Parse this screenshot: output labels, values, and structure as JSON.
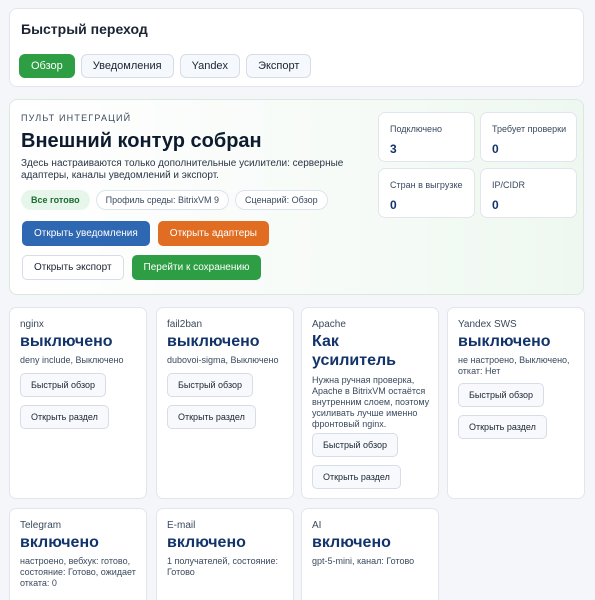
{
  "quick_nav": {
    "title": "Быстрый переход",
    "tabs": [
      "Обзор",
      "Уведомления",
      "Yandex",
      "Экспорт"
    ]
  },
  "console": {
    "eyebrow": "Пульт интеграций",
    "title": "Внешний контур собран",
    "description": "Здесь настраиваются только дополнительные усилители: серверные адаптеры, каналы уведомлений и экспорт.",
    "chips": [
      "Все готово",
      "Профиль среды: BitrixVM 9",
      "Сценарий: Обзор"
    ],
    "actions": [
      "Открыть уведомления",
      "Открыть адаптеры",
      "Открыть экспорт",
      "Перейти к сохранению"
    ],
    "stats": [
      {
        "label": "Подключено",
        "value": "3"
      },
      {
        "label": "Требует проверки",
        "value": "0"
      },
      {
        "label": "Стран в выгрузке",
        "value": "0"
      },
      {
        "label": "IP/CIDR",
        "value": "0"
      }
    ]
  },
  "services": [
    {
      "name": "nginx",
      "status": "выключено",
      "details": "deny include, Выключено",
      "btn_quick": "Быстрый обзор",
      "btn_open": "Открыть раздел"
    },
    {
      "name": "fail2ban",
      "status": "выключено",
      "details": "dubovoi-sigma, Выключено",
      "btn_quick": "Быстрый обзор",
      "btn_open": "Открыть раздел"
    },
    {
      "name": "Apache",
      "status": "Как усилитель",
      "details": "Нужна ручная проверка, Apache в BitrixVM остаётся внутренним слоем, поэтому усиливать лучше именно фронтовый nginx.",
      "btn_quick": "Быстрый обзор",
      "btn_open": "Открыть раздел"
    },
    {
      "name": "Yandex SWS",
      "status": "выключено",
      "details": "не настроено, Выключено, откат: Нет",
      "btn_quick": "Быстрый обзор",
      "btn_open": "Открыть раздел"
    },
    {
      "name": "Telegram",
      "status": "включено",
      "details": "настроено, вебхук: готово, состояние: Готово, ожидает отката: 0"
    },
    {
      "name": "E-mail",
      "status": "включено",
      "details": "1 получателей, состояние: Готово"
    },
    {
      "name": "AI",
      "status": "включено",
      "details": "gpt-5-mini, канал: Готово"
    }
  ]
}
